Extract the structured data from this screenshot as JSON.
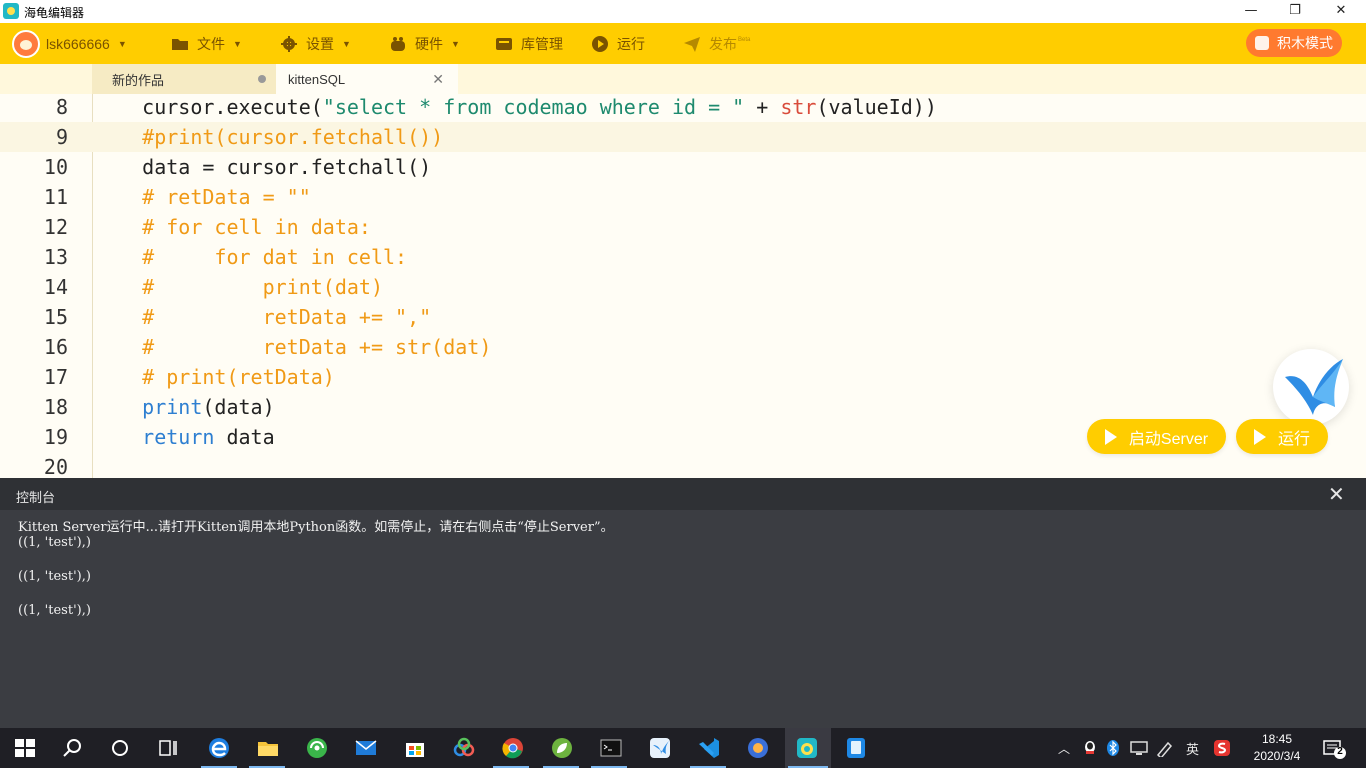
{
  "window": {
    "title": "海龟编辑器",
    "minimize_glyph": "—",
    "maximize_glyph": "❐",
    "close_glyph": "✕"
  },
  "menubar": {
    "username": "lsk666666",
    "items": [
      {
        "label": "文件",
        "icon": "folder-icon",
        "has_caret": true
      },
      {
        "label": "设置",
        "icon": "gear-icon",
        "has_caret": true
      },
      {
        "label": "硬件",
        "icon": "hardware-icon",
        "has_caret": true
      },
      {
        "label": "库管理",
        "icon": "library-icon",
        "has_caret": false
      },
      {
        "label": "运行",
        "icon": "play-icon",
        "has_caret": false
      },
      {
        "label": "发布",
        "icon": "paper-plane-icon",
        "has_caret": false,
        "badge": "Beta"
      }
    ],
    "block_mode_label": "积木模式",
    "caret_glyph": "▼"
  },
  "tabs": [
    {
      "label": "新的作品",
      "active": false
    },
    {
      "label": "kittenSQL",
      "active": true,
      "close_glyph": "✕"
    }
  ],
  "editor": {
    "lines": [
      {
        "num": "8",
        "segments": [
          {
            "t": "    cursor.execute(",
            "c": "plain"
          },
          {
            "t": "\"select * from codemao where id = \"",
            "c": "str"
          },
          {
            "t": " + ",
            "c": "plain"
          },
          {
            "t": "str",
            "c": "bi"
          },
          {
            "t": "(valueId))",
            "c": "plain"
          }
        ]
      },
      {
        "num": "9",
        "highlight": true,
        "segments": [
          {
            "t": "    #print(cursor.fetchall())",
            "c": "com"
          }
        ]
      },
      {
        "num": "10",
        "segments": [
          {
            "t": "    data = cursor.fetchall()",
            "c": "plain"
          }
        ]
      },
      {
        "num": "11",
        "segments": [
          {
            "t": "    # retData = \"\"",
            "c": "com"
          }
        ]
      },
      {
        "num": "12",
        "segments": [
          {
            "t": "    # for cell in data:",
            "c": "com"
          }
        ]
      },
      {
        "num": "13",
        "segments": [
          {
            "t": "    #     for dat in cell:",
            "c": "com"
          }
        ]
      },
      {
        "num": "14",
        "segments": [
          {
            "t": "    #         print(dat)",
            "c": "com"
          }
        ]
      },
      {
        "num": "15",
        "segments": [
          {
            "t": "    #         retData += \",\"",
            "c": "com"
          }
        ]
      },
      {
        "num": "16",
        "segments": [
          {
            "t": "    #         retData += str(dat)",
            "c": "com"
          }
        ]
      },
      {
        "num": "17",
        "segments": [
          {
            "t": "    # print(retData)",
            "c": "com"
          }
        ]
      },
      {
        "num": "18",
        "segments": [
          {
            "t": "    ",
            "c": "plain"
          },
          {
            "t": "print",
            "c": "kw"
          },
          {
            "t": "(data)",
            "c": "plain"
          }
        ]
      },
      {
        "num": "19",
        "segments": [
          {
            "t": "    ",
            "c": "plain"
          },
          {
            "t": "return",
            "c": "kw"
          },
          {
            "t": " data",
            "c": "plain"
          }
        ]
      },
      {
        "num": "20",
        "segments": [
          {
            "t": "",
            "c": "plain"
          }
        ]
      }
    ],
    "start_server_label": "启动Server",
    "run_label": "运行"
  },
  "console": {
    "title": "控制台",
    "close_glyph": "✕",
    "lines": [
      "Kitten Server运行中...请打开Kitten调用本地Python函数。如需停止，请在右侧点击“停止Server”。",
      "((1, 'test'),)",
      "((1, 'test'),)",
      "((1, 'test'),)"
    ]
  },
  "taskbar": {
    "apps": [
      "windows-start-icon",
      "search-icon",
      "cortana-icon",
      "task-view-icon",
      "edge-icon",
      "file-explorer-icon",
      "browser-360-icon",
      "mail-icon",
      "store-icon",
      "baidu-netdisk-icon",
      "chrome-icon",
      "spring-icon",
      "terminal-icon",
      "kitten-app-icon",
      "vscode-icon",
      "app-icon",
      "turtle-editor-icon",
      "phone-icon"
    ],
    "tray": {
      "caret": "︿",
      "ime_label": "英",
      "time": "18:45",
      "date": "2020/3/4",
      "notification_count": "2"
    }
  },
  "colors": {
    "accent": "#ffcd00",
    "block_mode": "#ff7a2f",
    "console_bg": "#3b3d42",
    "taskbar_bg": "#1f1f25"
  }
}
